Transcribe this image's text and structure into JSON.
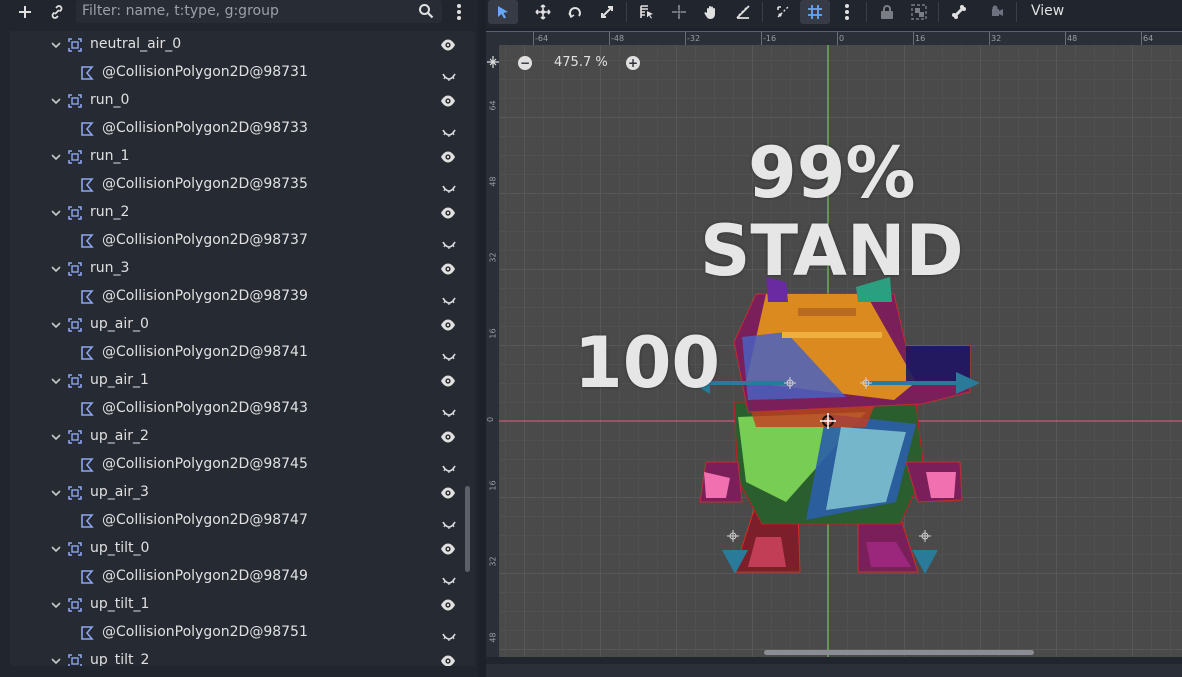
{
  "scene_dock": {
    "filter_placeholder": "Filter: name, t:type, g:group",
    "tree": [
      {
        "type": "area",
        "label": "neutral_air_0"
      },
      {
        "type": "polygon",
        "label": "@CollisionPolygon2D@98731"
      },
      {
        "type": "area",
        "label": "run_0"
      },
      {
        "type": "polygon",
        "label": "@CollisionPolygon2D@98733"
      },
      {
        "type": "area",
        "label": "run_1"
      },
      {
        "type": "polygon",
        "label": "@CollisionPolygon2D@98735"
      },
      {
        "type": "area",
        "label": "run_2"
      },
      {
        "type": "polygon",
        "label": "@CollisionPolygon2D@98737"
      },
      {
        "type": "area",
        "label": "run_3"
      },
      {
        "type": "polygon",
        "label": "@CollisionPolygon2D@98739"
      },
      {
        "type": "area",
        "label": "up_air_0"
      },
      {
        "type": "polygon",
        "label": "@CollisionPolygon2D@98741"
      },
      {
        "type": "area",
        "label": "up_air_1"
      },
      {
        "type": "polygon",
        "label": "@CollisionPolygon2D@98743"
      },
      {
        "type": "area",
        "label": "up_air_2"
      },
      {
        "type": "polygon",
        "label": "@CollisionPolygon2D@98745"
      },
      {
        "type": "area",
        "label": "up_air_3"
      },
      {
        "type": "polygon",
        "label": "@CollisionPolygon2D@98747"
      },
      {
        "type": "area",
        "label": "up_tilt_0"
      },
      {
        "type": "polygon",
        "label": "@CollisionPolygon2D@98749"
      },
      {
        "type": "area",
        "label": "up_tilt_1"
      },
      {
        "type": "polygon",
        "label": "@CollisionPolygon2D@98751"
      },
      {
        "type": "area",
        "label": "up_tilt_2"
      }
    ]
  },
  "viewport": {
    "view_menu": "View",
    "zoom": "475.7 %",
    "ruler_top": [
      "-64",
      "-48",
      "-32",
      "-16",
      "0",
      "16",
      "32",
      "48",
      "64"
    ],
    "ruler_left": [
      "64",
      "48",
      "32",
      "16",
      "0",
      "16",
      "32",
      "48"
    ],
    "overlay": {
      "percent": "99%",
      "state": "STAND",
      "number": "100"
    }
  },
  "colors": {
    "accent": "#67a8f5",
    "panel_bg": "#21252d",
    "tree_bg": "#262a33",
    "area_icon": "#8da5f3",
    "viewport_bg": "#4a4a4a",
    "x_axis": "#e06080",
    "y_axis": "#80e060"
  }
}
